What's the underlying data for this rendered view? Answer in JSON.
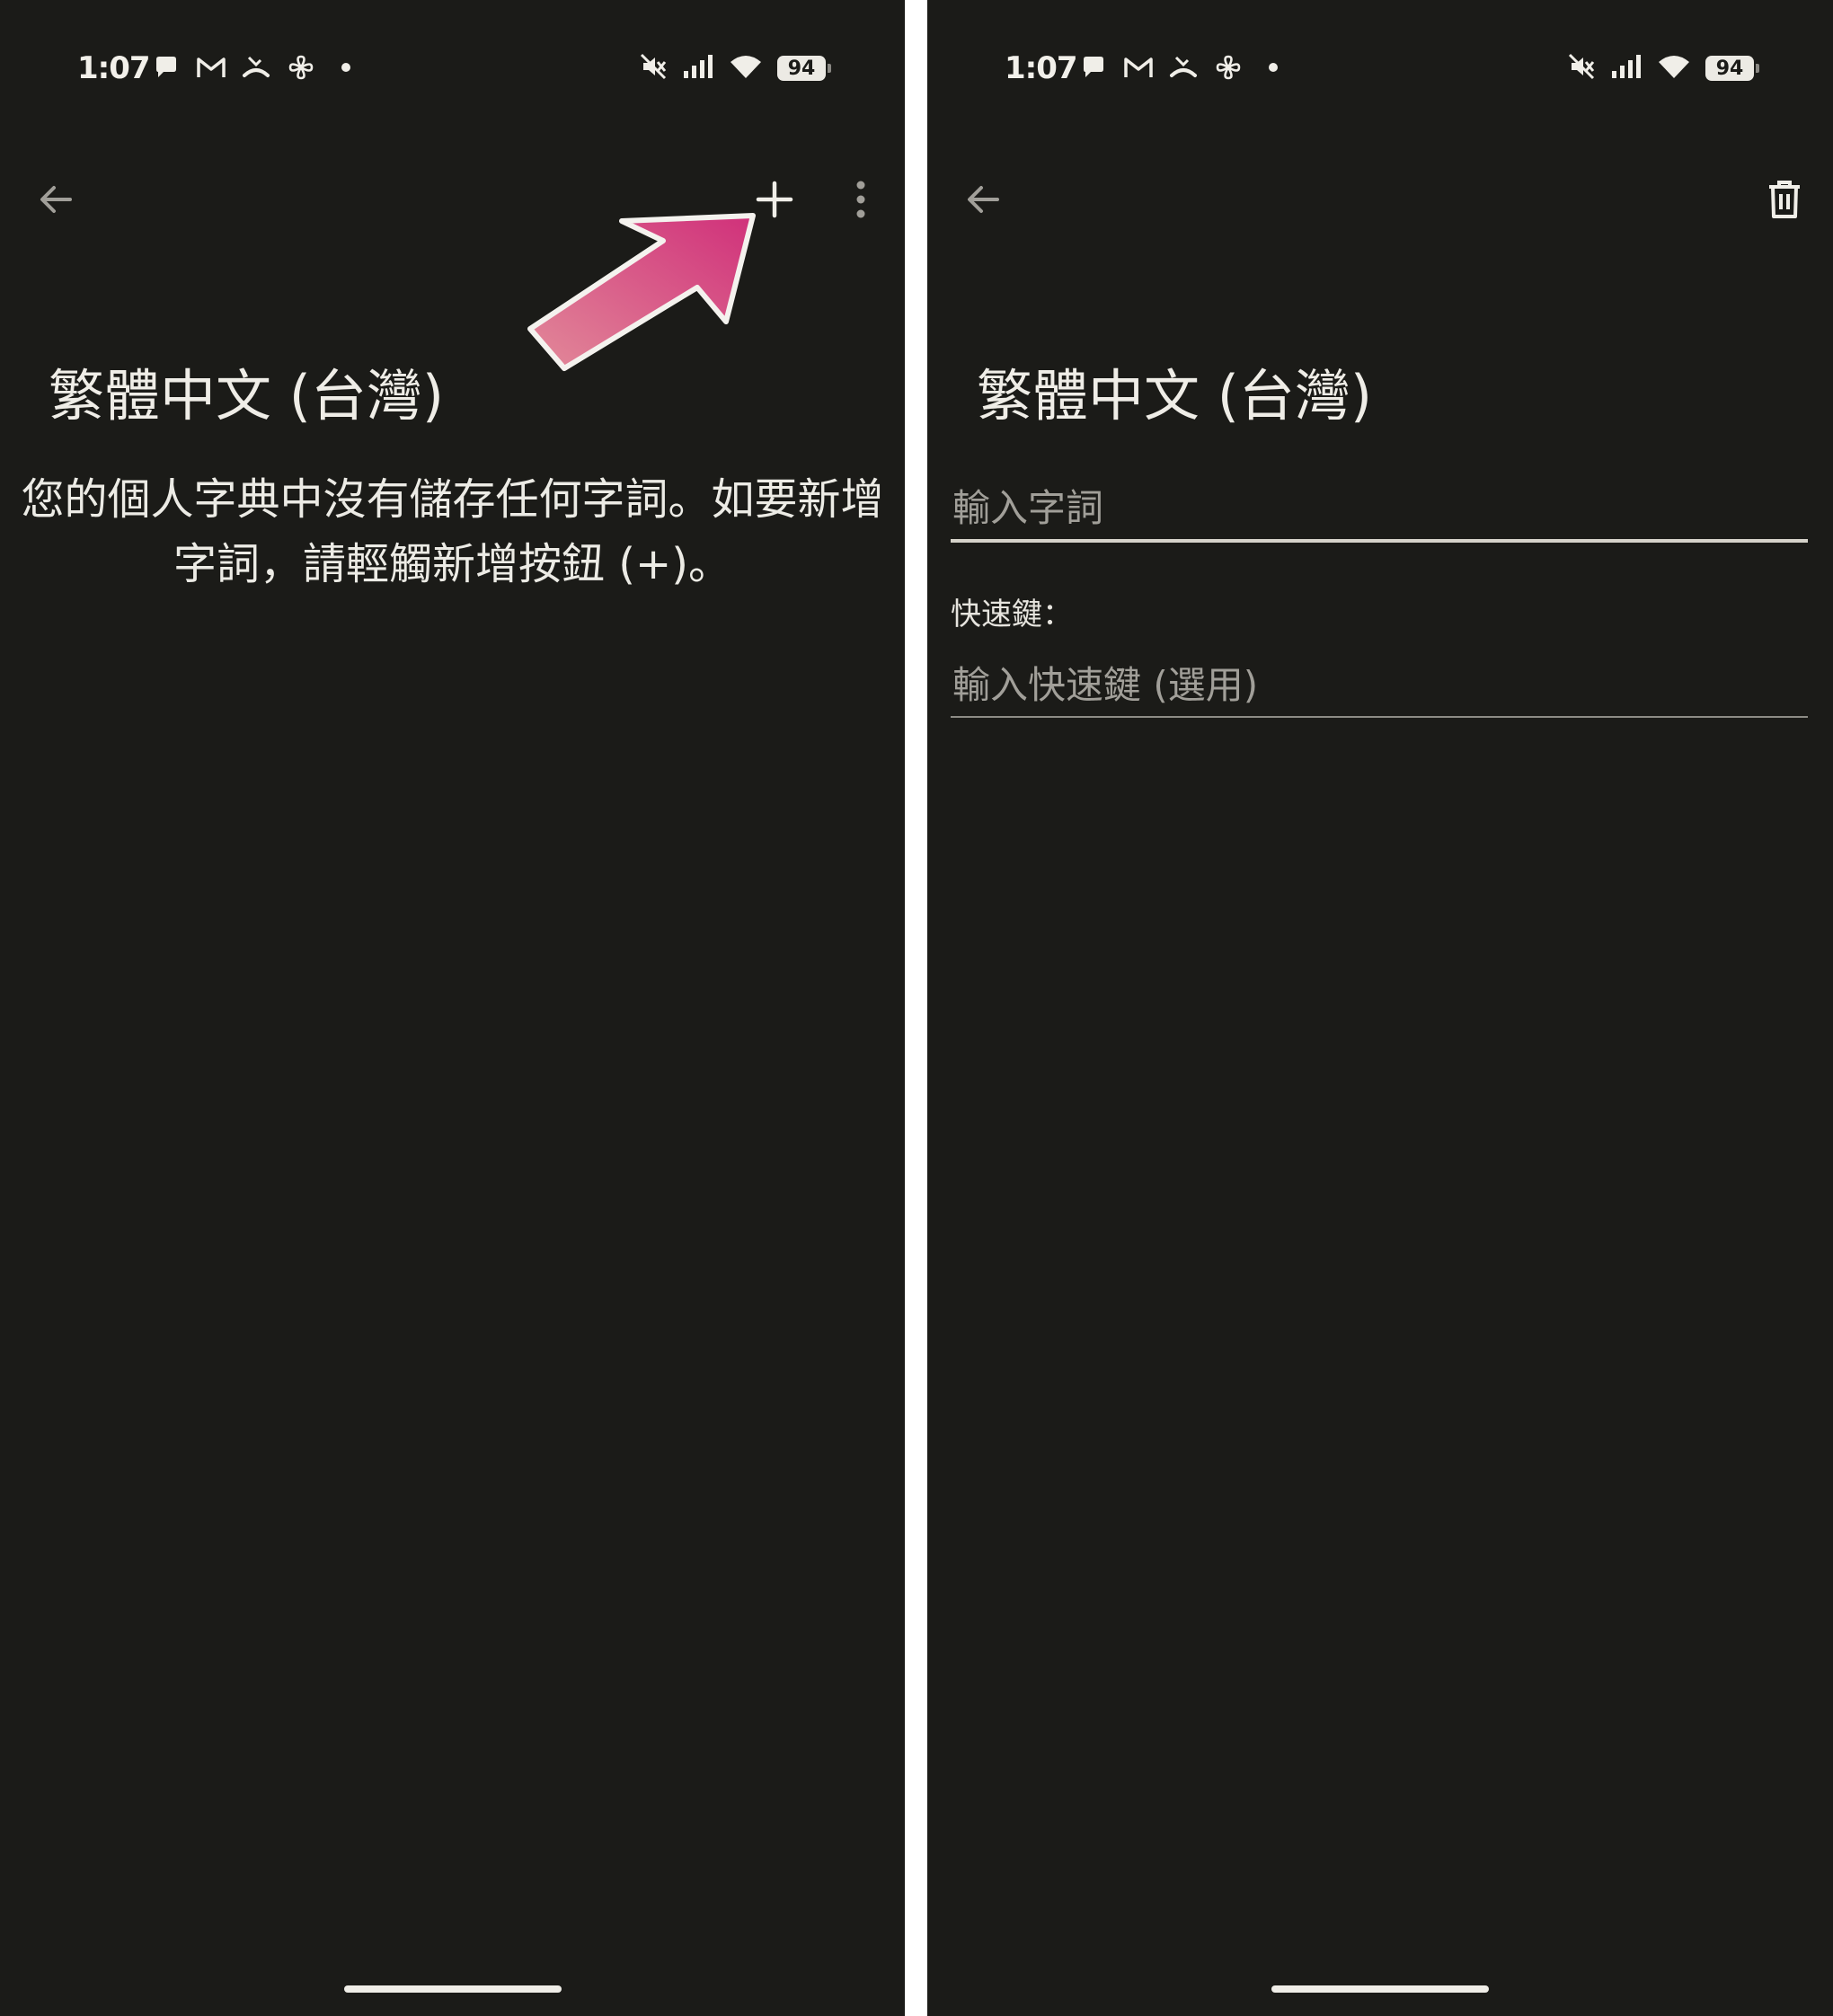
{
  "status_bar": {
    "time": "1:07",
    "notification_icons": [
      "chat-bubble-icon",
      "gmail-icon",
      "missed-call-icon",
      "pinwheel-icon",
      "dot-icon"
    ],
    "system_icons": [
      "mute-icon",
      "signal-icon",
      "wifi-icon"
    ],
    "battery": "94"
  },
  "left_screen": {
    "title": "繁體中文 (台灣)",
    "empty_message": "您的個人字典中沒有儲存任何字詞。如要新增字詞，請輕觸新增按鈕 (+)。",
    "annotation_arrow_colors": [
      "#e28a99",
      "#d0307a"
    ]
  },
  "right_screen": {
    "title": "繁體中文 (台灣)",
    "word_input_placeholder": "輸入字詞",
    "word_input_value": "",
    "shortcut_label": "快速鍵：",
    "shortcut_input_placeholder": "輸入快速鍵 (選用)",
    "shortcut_input_value": ""
  },
  "colors": {
    "background": "#1b1b18",
    "text": "#e9e7e1",
    "accent_underline": "#d6d3ca"
  }
}
